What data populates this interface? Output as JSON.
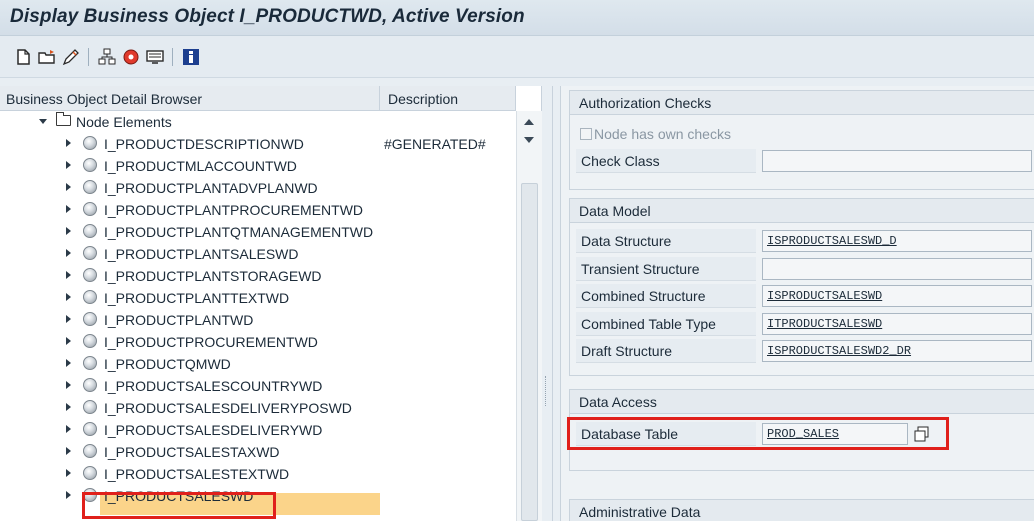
{
  "window": {
    "title": "Display Business Object I_PRODUCTWD, Active Version"
  },
  "toolbar": {
    "icons": [
      "new-document-icon",
      "open-folder-icon",
      "edit-pencil-icon",
      "hierarchy-icon",
      "object-ball-icon",
      "display-screen-icon",
      "info-icon"
    ]
  },
  "tree": {
    "headers": {
      "name": "Business Object Detail Browser",
      "description": "Description"
    },
    "root": "Node Elements",
    "items": [
      {
        "label": "I_PRODUCTDESCRIPTIONWD",
        "description": "#GENERATED#"
      },
      {
        "label": "I_PRODUCTMLACCOUNTWD",
        "description": ""
      },
      {
        "label": "I_PRODUCTPLANTADVPLANWD",
        "description": ""
      },
      {
        "label": "I_PRODUCTPLANTPROCUREMENTWD",
        "description": ""
      },
      {
        "label": "I_PRODUCTPLANTQTMANAGEMENTWD",
        "description": ""
      },
      {
        "label": "I_PRODUCTPLANTSALESWD",
        "description": ""
      },
      {
        "label": "I_PRODUCTPLANTSTORAGEWD",
        "description": ""
      },
      {
        "label": "I_PRODUCTPLANTTEXTWD",
        "description": ""
      },
      {
        "label": "I_PRODUCTPLANTWD",
        "description": ""
      },
      {
        "label": "I_PRODUCTPROCUREMENTWD",
        "description": ""
      },
      {
        "label": "I_PRODUCTQMWD",
        "description": ""
      },
      {
        "label": "I_PRODUCTSALESCOUNTRYWD",
        "description": ""
      },
      {
        "label": "I_PRODUCTSALESDELIVERYPOSWD",
        "description": ""
      },
      {
        "label": "I_PRODUCTSALESDELIVERYWD",
        "description": ""
      },
      {
        "label": "I_PRODUCTSALESTAXWD",
        "description": ""
      },
      {
        "label": "I_PRODUCTSALESTEXTWD",
        "description": ""
      },
      {
        "label": "I_PRODUCTSALESWD",
        "description": "",
        "selected": true
      }
    ]
  },
  "authorization": {
    "title": "Authorization Checks",
    "checkbox_label": "Node has own checks",
    "checkbox_checked": false,
    "check_class_label": "Check Class",
    "check_class_value": ""
  },
  "data_model": {
    "title": "Data Model",
    "fields": [
      {
        "label": "Data Structure",
        "value": "ISPRODUCTSALESWD_D"
      },
      {
        "label": "Transient Structure",
        "value": ""
      },
      {
        "label": "Combined Structure",
        "value": "ISPRODUCTSALESWD"
      },
      {
        "label": "Combined Table Type",
        "value": "ITPRODUCTSALESWD"
      },
      {
        "label": "Draft Structure",
        "value": "ISPRODUCTSALESWD2_DR"
      }
    ]
  },
  "data_access": {
    "title": "Data Access",
    "database_table_label": "Database Table",
    "database_table_value": "PROD_SALES"
  },
  "admin": {
    "title": "Administrative Data"
  },
  "colors": {
    "highlight": "#fbd48a",
    "annotation_red": "#e0201b",
    "accent_dark": "#1a2a3a"
  }
}
